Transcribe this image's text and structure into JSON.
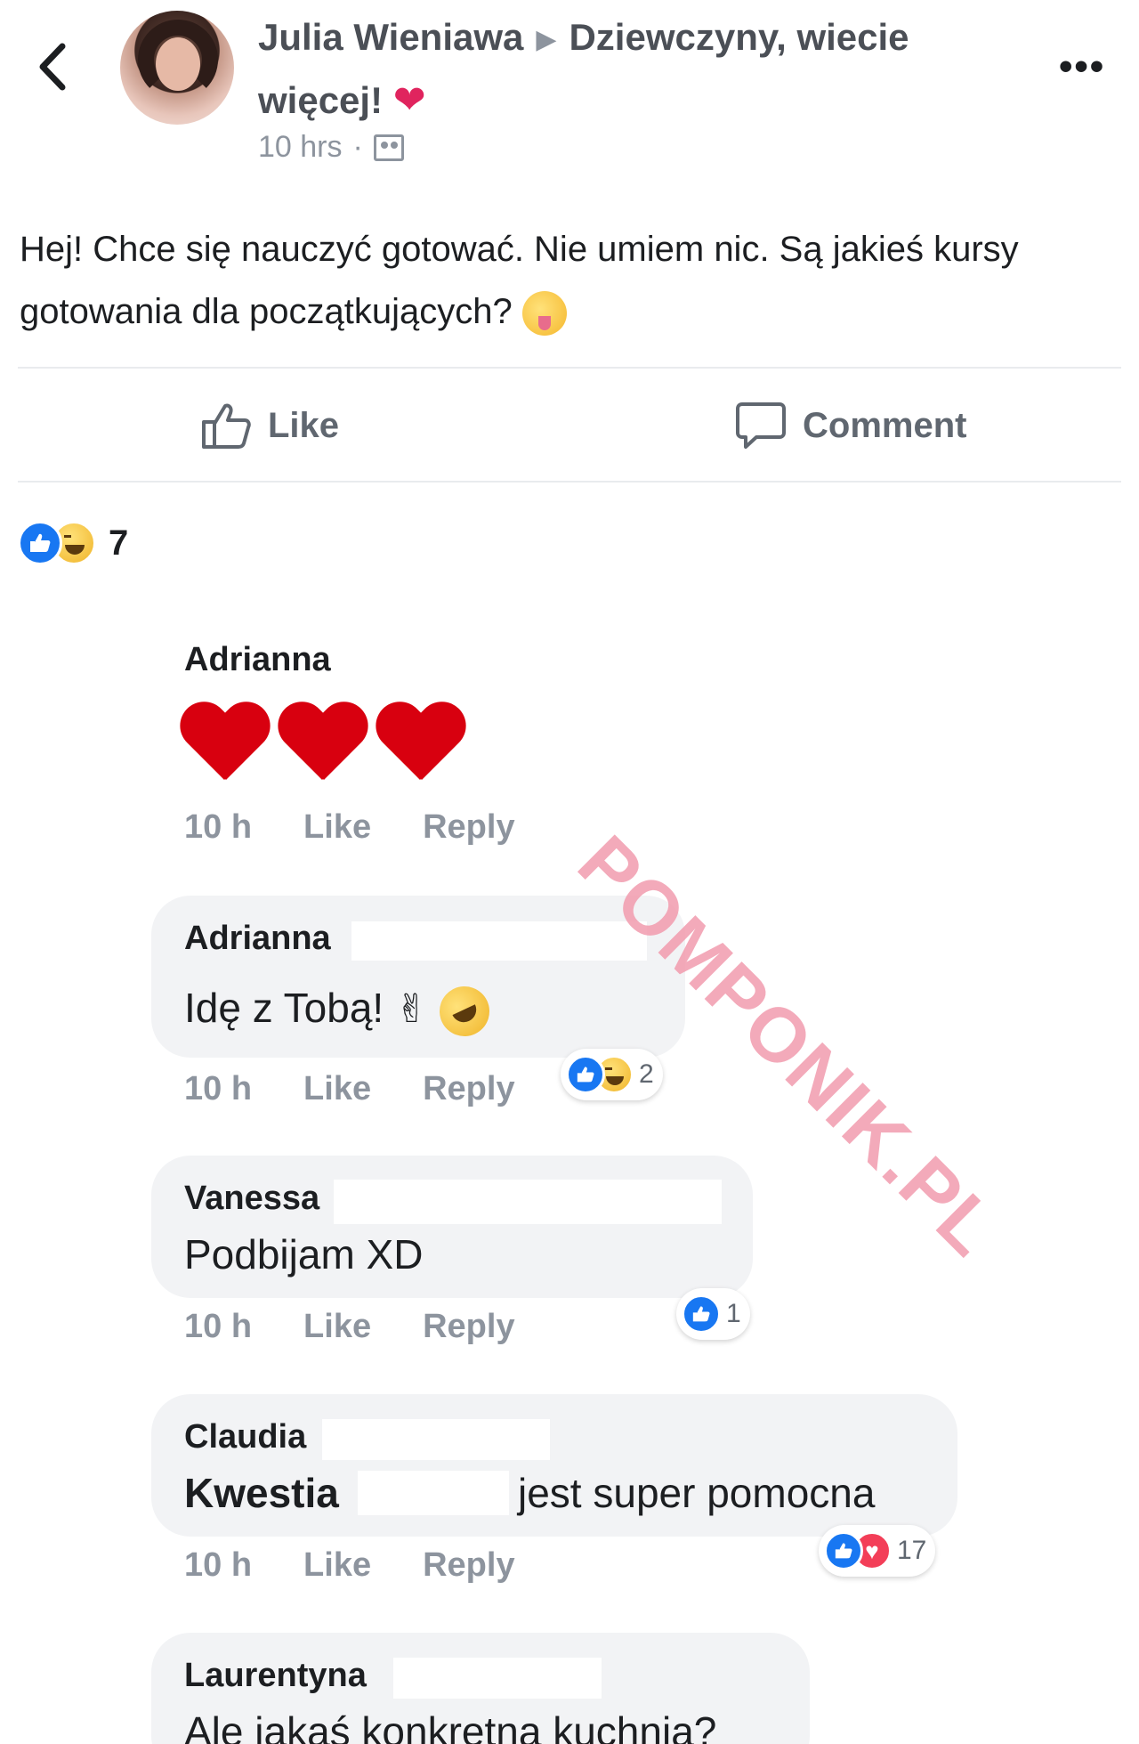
{
  "header": {
    "author": "Julia Wieniawa",
    "group": "Dziewczyny, wiecie więcej!",
    "time": "10 hrs",
    "separator": "·"
  },
  "post": {
    "text": "Hej! Chce się nauczyć gotować. Nie umiem nic. Są jakieś kursy gotowania dla początkujących?"
  },
  "actions": {
    "like": "Like",
    "comment": "Comment"
  },
  "reactions": {
    "count": "7"
  },
  "comments": [
    {
      "name": "Adrianna",
      "text": "",
      "time": "10 h",
      "like": "Like",
      "reply": "Reply",
      "reaction_count": ""
    },
    {
      "name": "Adrianna",
      "text": "Idę z Tobą!",
      "time": "10 h",
      "like": "Like",
      "reply": "Reply",
      "reaction_count": "2"
    },
    {
      "name": "Vanessa",
      "text": "Podbijam XD",
      "time": "10 h",
      "like": "Like",
      "reply": "Reply",
      "reaction_count": "1"
    },
    {
      "name": "Claudia",
      "text_before": "Kwestia",
      "text_after": "jest super pomocna",
      "time": "10 h",
      "like": "Like",
      "reply": "Reply",
      "reaction_count": "17"
    },
    {
      "name": "Laurentyna",
      "text": "Ale jakaś konkretna kuchnia?"
    }
  ],
  "watermark": "POMPONIK.PL",
  "colors": {
    "accent": "#1877f2",
    "love": "#f33e58",
    "watermark": "#f29cae"
  }
}
